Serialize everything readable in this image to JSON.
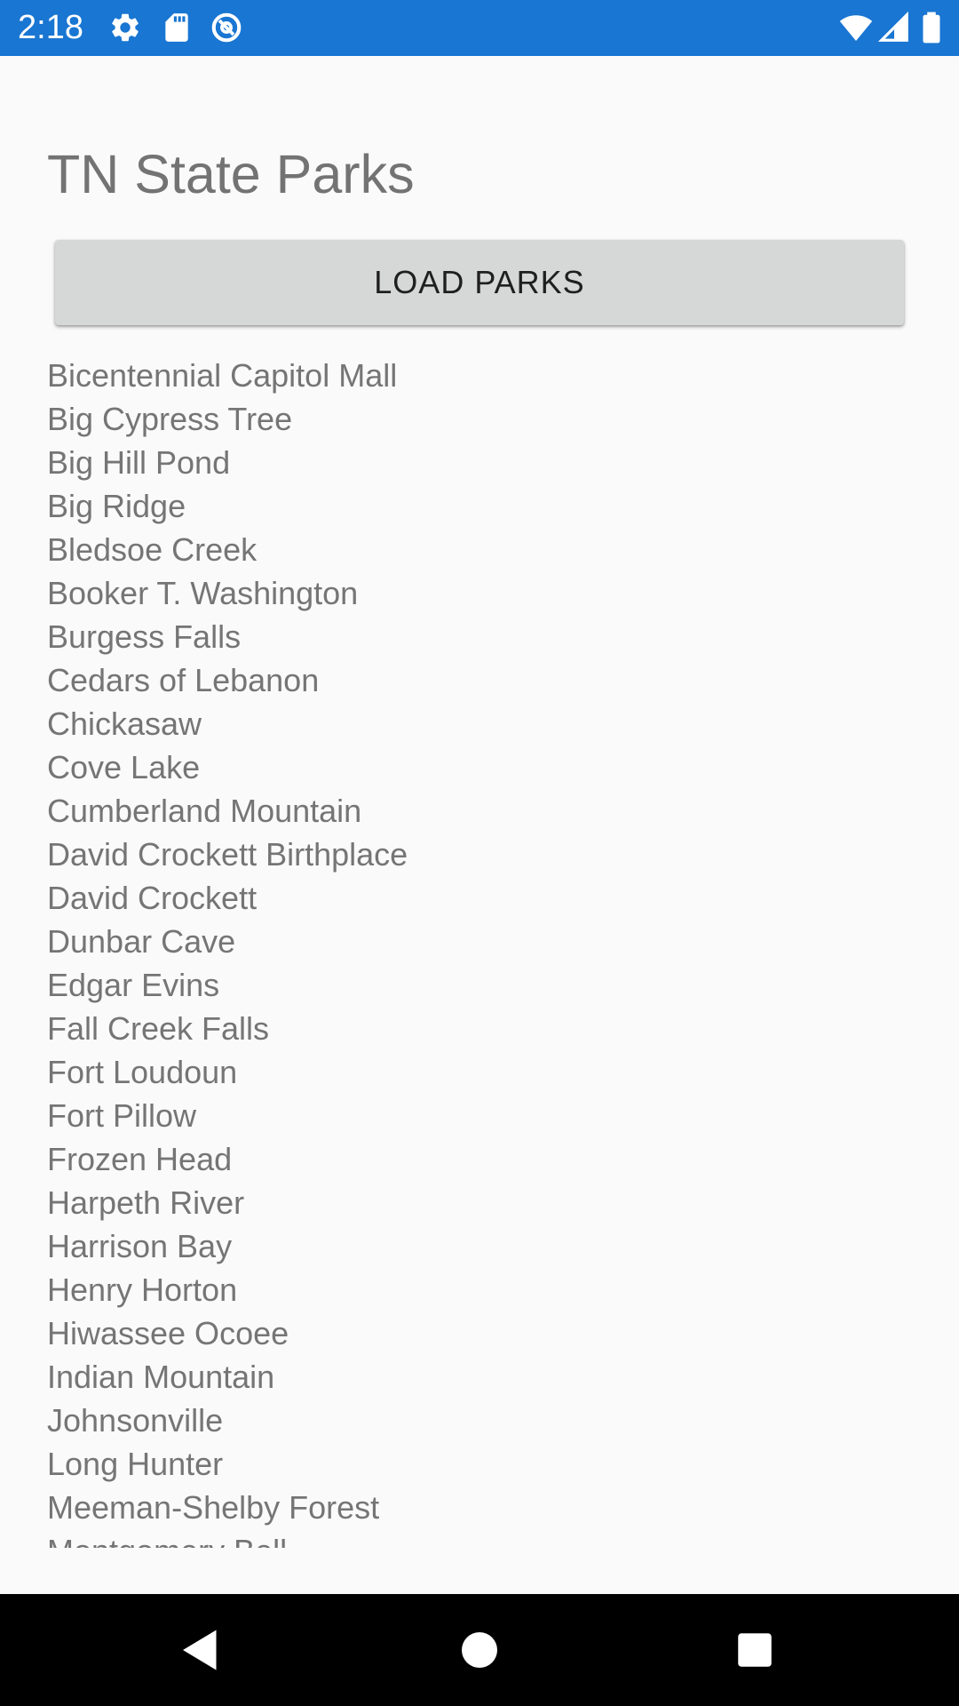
{
  "status_bar": {
    "time": "2:18",
    "background_color": "#1976d2",
    "left_icons": [
      "gear-icon",
      "sd-card-icon",
      "at-sign-icon"
    ],
    "right_icons": [
      "wifi-icon",
      "cell-signal-icon",
      "battery-icon"
    ]
  },
  "app": {
    "title": "TN State Parks",
    "load_button_label": "LOAD PARKS"
  },
  "parks": [
    "Bicentennial Capitol Mall",
    "Big Cypress Tree",
    "Big Hill Pond",
    "Big Ridge",
    "Bledsoe Creek",
    "Booker T. Washington",
    "Burgess Falls",
    "Cedars of Lebanon",
    "Chickasaw",
    "Cove Lake",
    "Cumberland Mountain",
    "David Crockett Birthplace",
    "David Crockett",
    "Dunbar Cave",
    "Edgar Evins",
    "Fall Creek Falls",
    "Fort Loudoun",
    "Fort Pillow",
    "Frozen Head",
    "Harpeth River",
    "Harrison Bay",
    "Henry Horton",
    "Hiwassee Ocoee",
    "Indian Mountain",
    "Johnsonville",
    "Long Hunter",
    "Meeman-Shelby Forest",
    "Montgomery Bell"
  ],
  "nav_bar": {
    "buttons": [
      "back-icon",
      "home-icon",
      "recents-icon"
    ]
  }
}
